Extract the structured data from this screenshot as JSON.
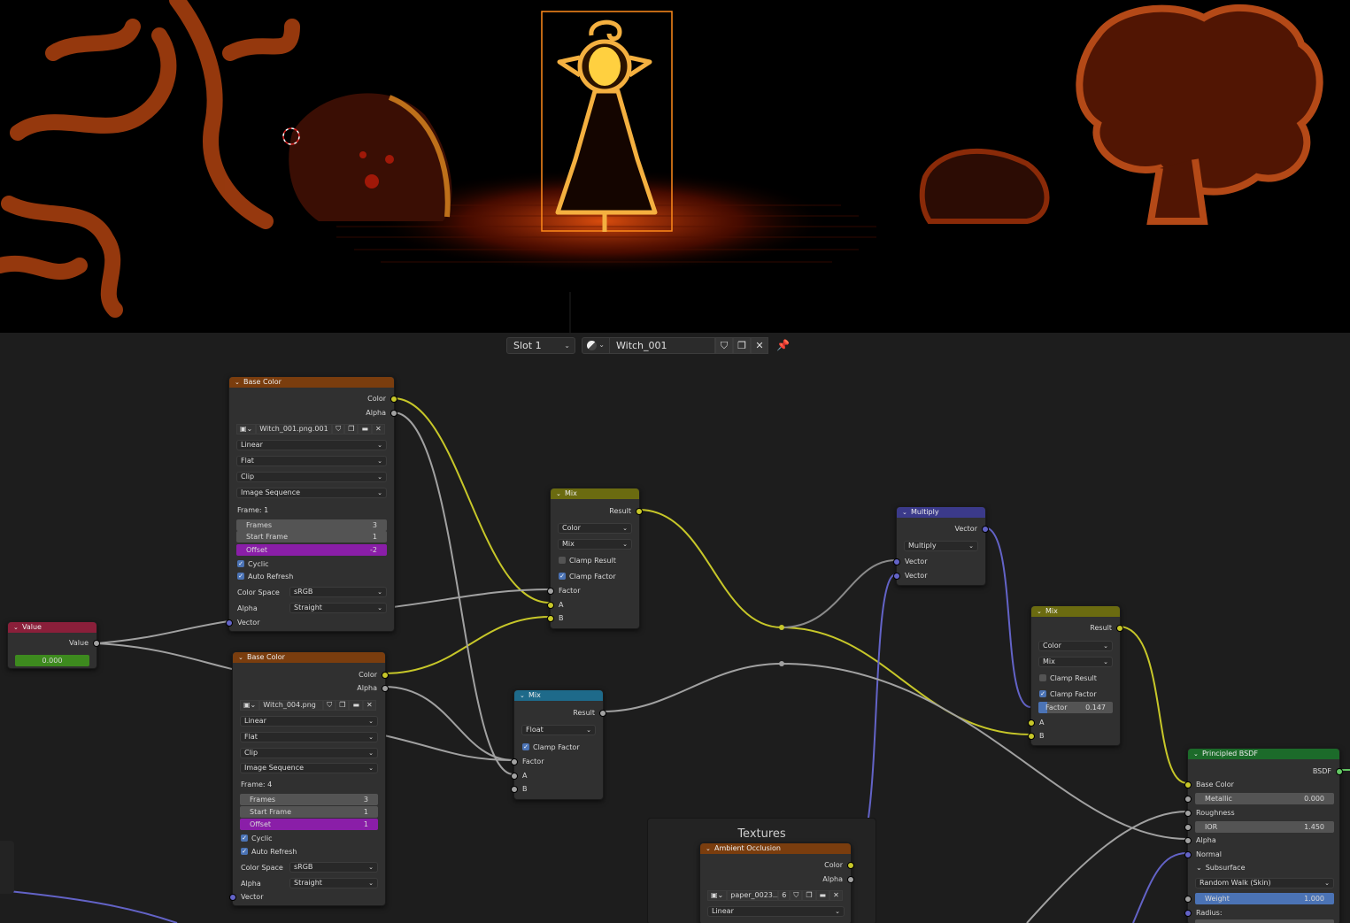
{
  "viewport": {
    "description_icon": "cursor-circle-icon"
  },
  "header": {
    "slot_label": "Slot 1",
    "material_name": "Witch_001",
    "icons": [
      "sphere-material-icon",
      "shield-fake-user-icon",
      "duplicate-icon",
      "close-icon",
      "pin-icon"
    ]
  },
  "nodes": {
    "value": {
      "title": "Value",
      "socket_out": "Value",
      "field_value": "0.000",
      "color": "#8a1f3a"
    },
    "base_color_1": {
      "title": "Base Color",
      "outputs": [
        "Color",
        "Alpha"
      ],
      "image_name": "Witch_001.png.001",
      "interpolation": "Linear",
      "projection": "Flat",
      "extension": "Clip",
      "source": "Image Sequence",
      "frame_text": "Frame: 1",
      "frames_label": "Frames",
      "frames_value": "3",
      "start_label": "Start Frame",
      "start_value": "1",
      "offset_label": "Offset",
      "offset_value": "-2",
      "cyclic": "Cyclic",
      "auto_refresh": "Auto Refresh",
      "color_space_label": "Color Space",
      "color_space": "sRGB",
      "alpha_label": "Alpha",
      "alpha_mode": "Straight",
      "vector": "Vector"
    },
    "base_color_2": {
      "title": "Base Color",
      "outputs": [
        "Color",
        "Alpha"
      ],
      "image_name": "Witch_004.png",
      "interpolation": "Linear",
      "projection": "Flat",
      "extension": "Clip",
      "source": "Image Sequence",
      "frame_text": "Frame: 4",
      "frames_label": "Frames",
      "frames_value": "3",
      "start_label": "Start Frame",
      "start_value": "1",
      "offset_label": "Offset",
      "offset_value": "1",
      "cyclic": "Cyclic",
      "auto_refresh": "Auto Refresh",
      "color_space_label": "Color Space",
      "color_space": "sRGB",
      "alpha_label": "Alpha",
      "alpha_mode": "Straight",
      "vector": "Vector"
    },
    "mix_1": {
      "title": "Mix",
      "result": "Result",
      "type": "Color",
      "blend": "Mix",
      "clamp_result": "Clamp Result",
      "clamp_factor": "Clamp Factor",
      "factor": "Factor",
      "a": "A",
      "b": "B"
    },
    "mix_float": {
      "title": "Mix",
      "result": "Result",
      "type": "Float",
      "clamp_factor": "Clamp Factor",
      "factor": "Factor",
      "a": "A",
      "b": "B"
    },
    "multiply": {
      "title": "Multiply",
      "output": "Vector",
      "op": "Multiply",
      "in1": "Vector",
      "in2": "Vector"
    },
    "mix_2": {
      "title": "Mix",
      "result": "Result",
      "type": "Color",
      "blend": "Mix",
      "clamp_result": "Clamp Result",
      "clamp_factor": "Clamp Factor",
      "factor_label": "Factor",
      "factor_value": "0.147",
      "a": "A",
      "b": "B"
    },
    "principled": {
      "title": "Principled BSDF",
      "output": "BSDF",
      "base_color": "Base Color",
      "metallic_label": "Metallic",
      "metallic": "0.000",
      "roughness": "Roughness",
      "ior_label": "IOR",
      "ior": "1.450",
      "alpha": "Alpha",
      "normal": "Normal",
      "subsurface": "Subsurface",
      "sss_method": "Random Walk (Skin)",
      "weight_label": "Weight",
      "weight": "1.000",
      "radius": "Radius:"
    },
    "frame_textures": {
      "label": "Textures"
    },
    "ambient_occlusion": {
      "title": "Ambient Occlusion",
      "outputs": [
        "Color",
        "Alpha"
      ],
      "image_name": "paper_0023...",
      "users": "6",
      "interpolation": "Linear"
    }
  },
  "colors": {
    "texture_header": "#7a3d0e",
    "mix_header": "#6b6b10",
    "float_mix_header": "#1e6a8a",
    "vector_header": "#3b3a8a",
    "shader_header": "#1c6b2a",
    "value_header": "#8a1f3a",
    "socket_color": "#c7c729",
    "socket_gray": "#a1a1a1",
    "socket_vector": "#6363c7",
    "socket_shader": "#63c763",
    "offset_purple": "#8a1ea8",
    "accent_blue": "#4b73b5"
  }
}
